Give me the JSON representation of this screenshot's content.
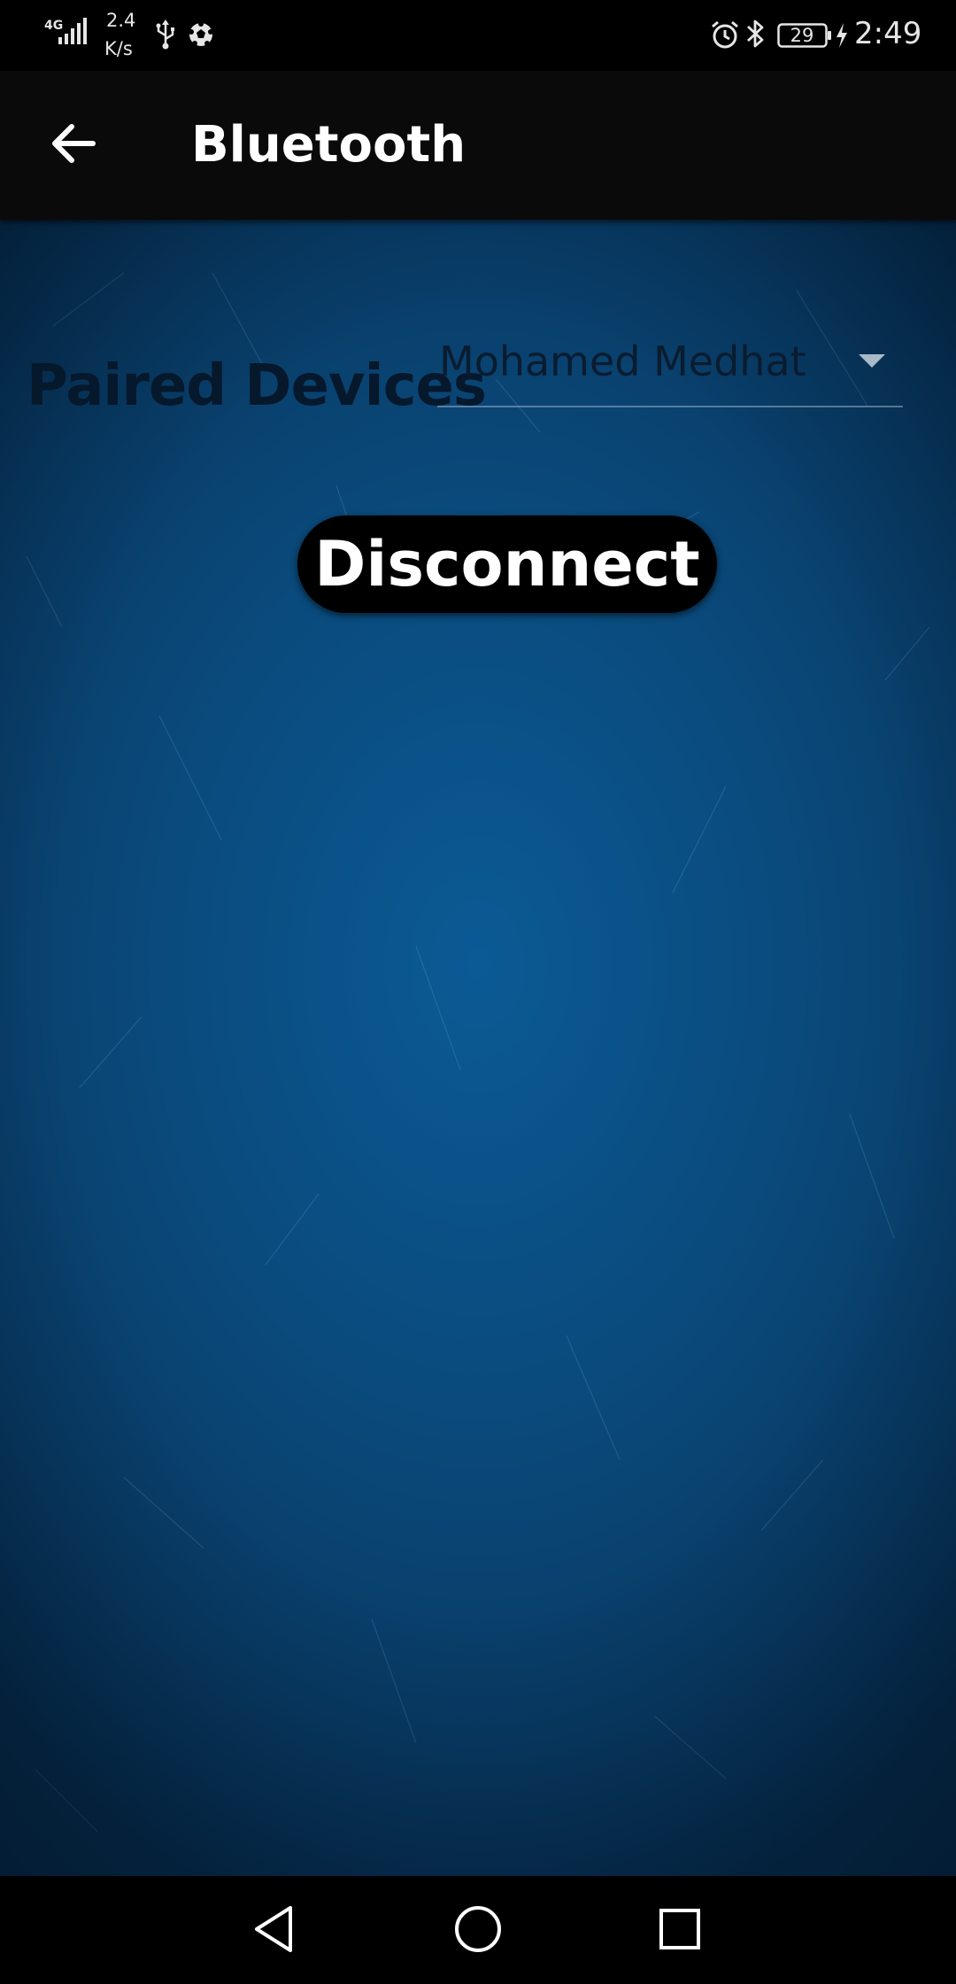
{
  "status_bar": {
    "network_type": "4G",
    "speed_value": "2.4",
    "speed_unit": "K/s",
    "battery_level": "29",
    "time": "2:49",
    "icons": [
      "signal-icon",
      "usb-icon",
      "soccer-ball-icon",
      "alarm-icon",
      "bluetooth-icon",
      "battery-icon",
      "charging-icon"
    ]
  },
  "app_bar": {
    "title": "Bluetooth",
    "back_icon": "arrow-left-icon"
  },
  "main": {
    "paired_devices_label": "Paired Devices",
    "selected_device": "Mohamed Medhat",
    "disconnect_label": "Disconnect"
  },
  "nav_bar": {
    "icons": [
      "triangle-back-icon",
      "circle-home-icon",
      "square-recents-icon"
    ]
  },
  "colors": {
    "background": "#0a4a7c",
    "app_bar": "#0a0a0a",
    "label_text": "#06182b",
    "button_bg": "#000000",
    "button_text": "#ffffff"
  }
}
